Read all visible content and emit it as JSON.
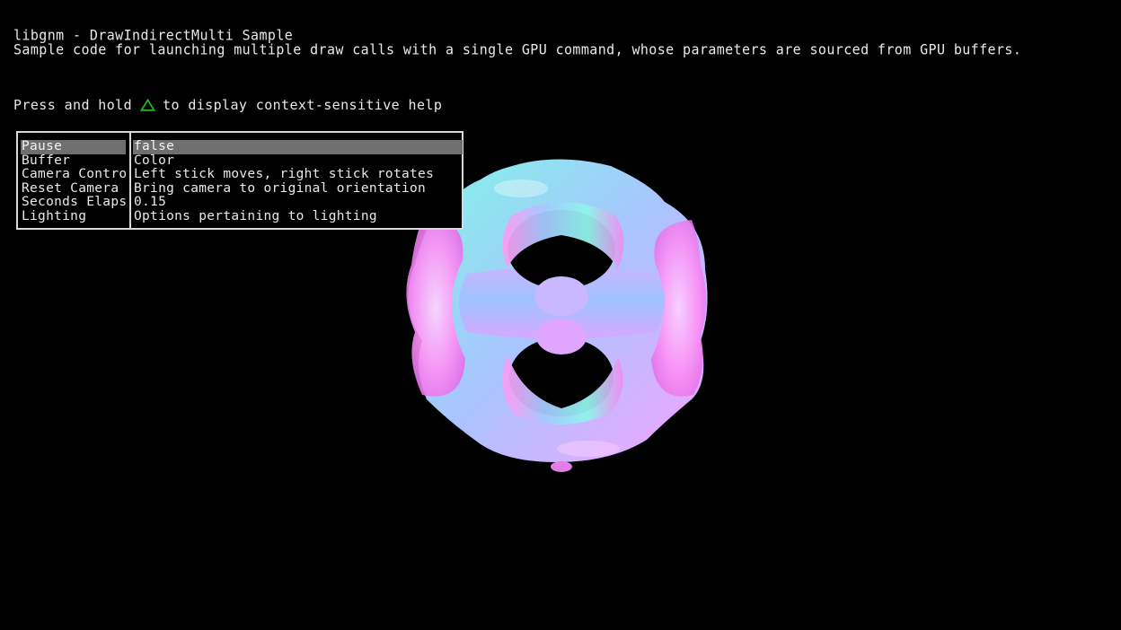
{
  "header": {
    "title": "libgnm - DrawIndirectMulti Sample",
    "subtitle": "Sample code for launching multiple draw calls with a single GPU command, whose parameters are sourced from GPU buffers."
  },
  "help_hint": {
    "prefix": "Press and hold",
    "button_icon": "triangle-button-icon",
    "suffix": "to display context-sensitive help",
    "icon_color": "#1fb81f"
  },
  "menu": {
    "items": [
      {
        "label": "Pause",
        "value": "false",
        "selected": true
      },
      {
        "label": "Buffer",
        "value": "Color",
        "selected": false
      },
      {
        "label": "Camera Controls",
        "value": "Left stick moves, right stick rotates",
        "selected": false
      },
      {
        "label": "Reset Camera",
        "value": "Bring camera to original orientation",
        "selected": false
      },
      {
        "label": "Seconds Elapsed",
        "value": "0.15",
        "selected": false
      },
      {
        "label": "Lighting",
        "value": "Options pertaining to lighting",
        "selected": false
      }
    ]
  },
  "scene": {
    "object": "normal-shaded-torus-lattice",
    "colors": [
      "#ff88ff",
      "#88ffee",
      "#aab8ff",
      "#ffffff"
    ]
  }
}
